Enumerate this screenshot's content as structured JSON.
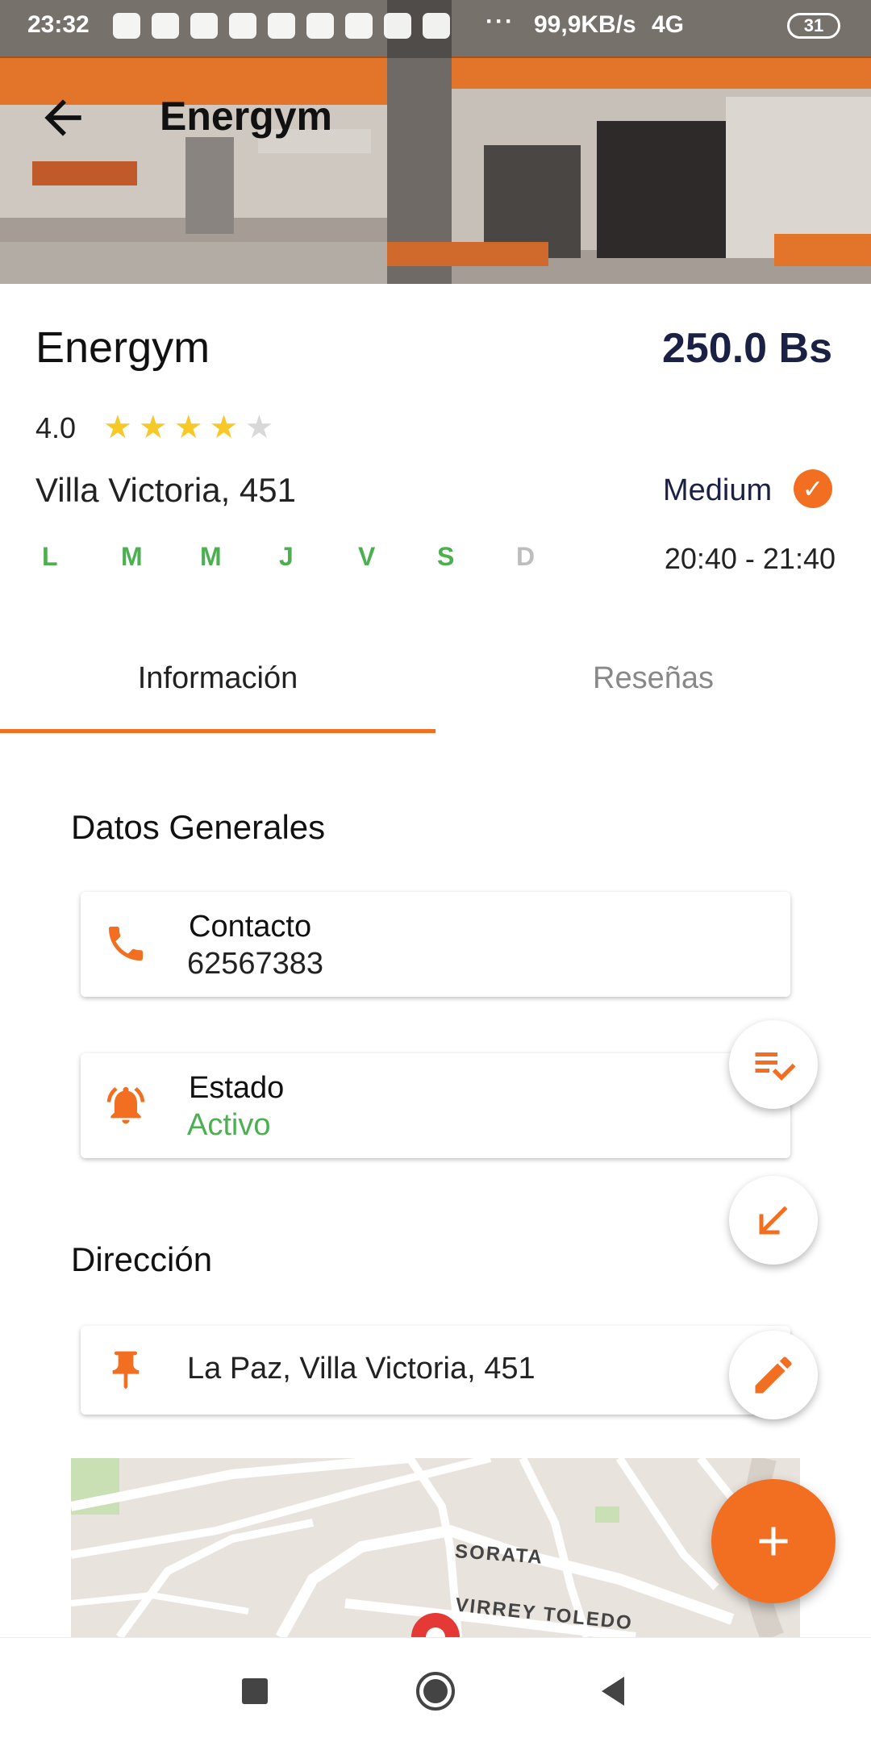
{
  "status_bar": {
    "time": "23:32",
    "dots": "···",
    "network_speed": "99,9KB/s",
    "signal": "4G",
    "battery": "31"
  },
  "toolbar": {
    "title": "Energym",
    "back_icon": "arrow-left-icon"
  },
  "gym": {
    "name": "Energym",
    "price": "250.0 Bs",
    "rating": "4.0",
    "rating_stars": 4,
    "max_stars": 5,
    "address_short": "Villa Victoria, 451",
    "level": "Medium",
    "schedule": "20:40 - 21:40",
    "days": [
      {
        "label": "L",
        "active": true
      },
      {
        "label": "M",
        "active": true
      },
      {
        "label": "M",
        "active": true
      },
      {
        "label": "J",
        "active": true
      },
      {
        "label": "V",
        "active": true
      },
      {
        "label": "S",
        "active": true
      },
      {
        "label": "D",
        "active": false
      }
    ]
  },
  "tabs": {
    "info": "Información",
    "reviews": "Reseñas"
  },
  "general": {
    "title": "Datos Generales",
    "contact_label": "Contacto",
    "contact_value": "62567383",
    "status_label": "Estado",
    "status_value": "Activo"
  },
  "direction": {
    "title": "Dirección",
    "address": "La Paz, Villa Victoria, 451"
  },
  "map": {
    "street_1": "SORATA",
    "street_2": "VIRREY TOLEDO"
  },
  "colors": {
    "accent": "#f26f21",
    "price": "#1b2144",
    "active_green": "#4caf50",
    "star": "#f7c928"
  }
}
